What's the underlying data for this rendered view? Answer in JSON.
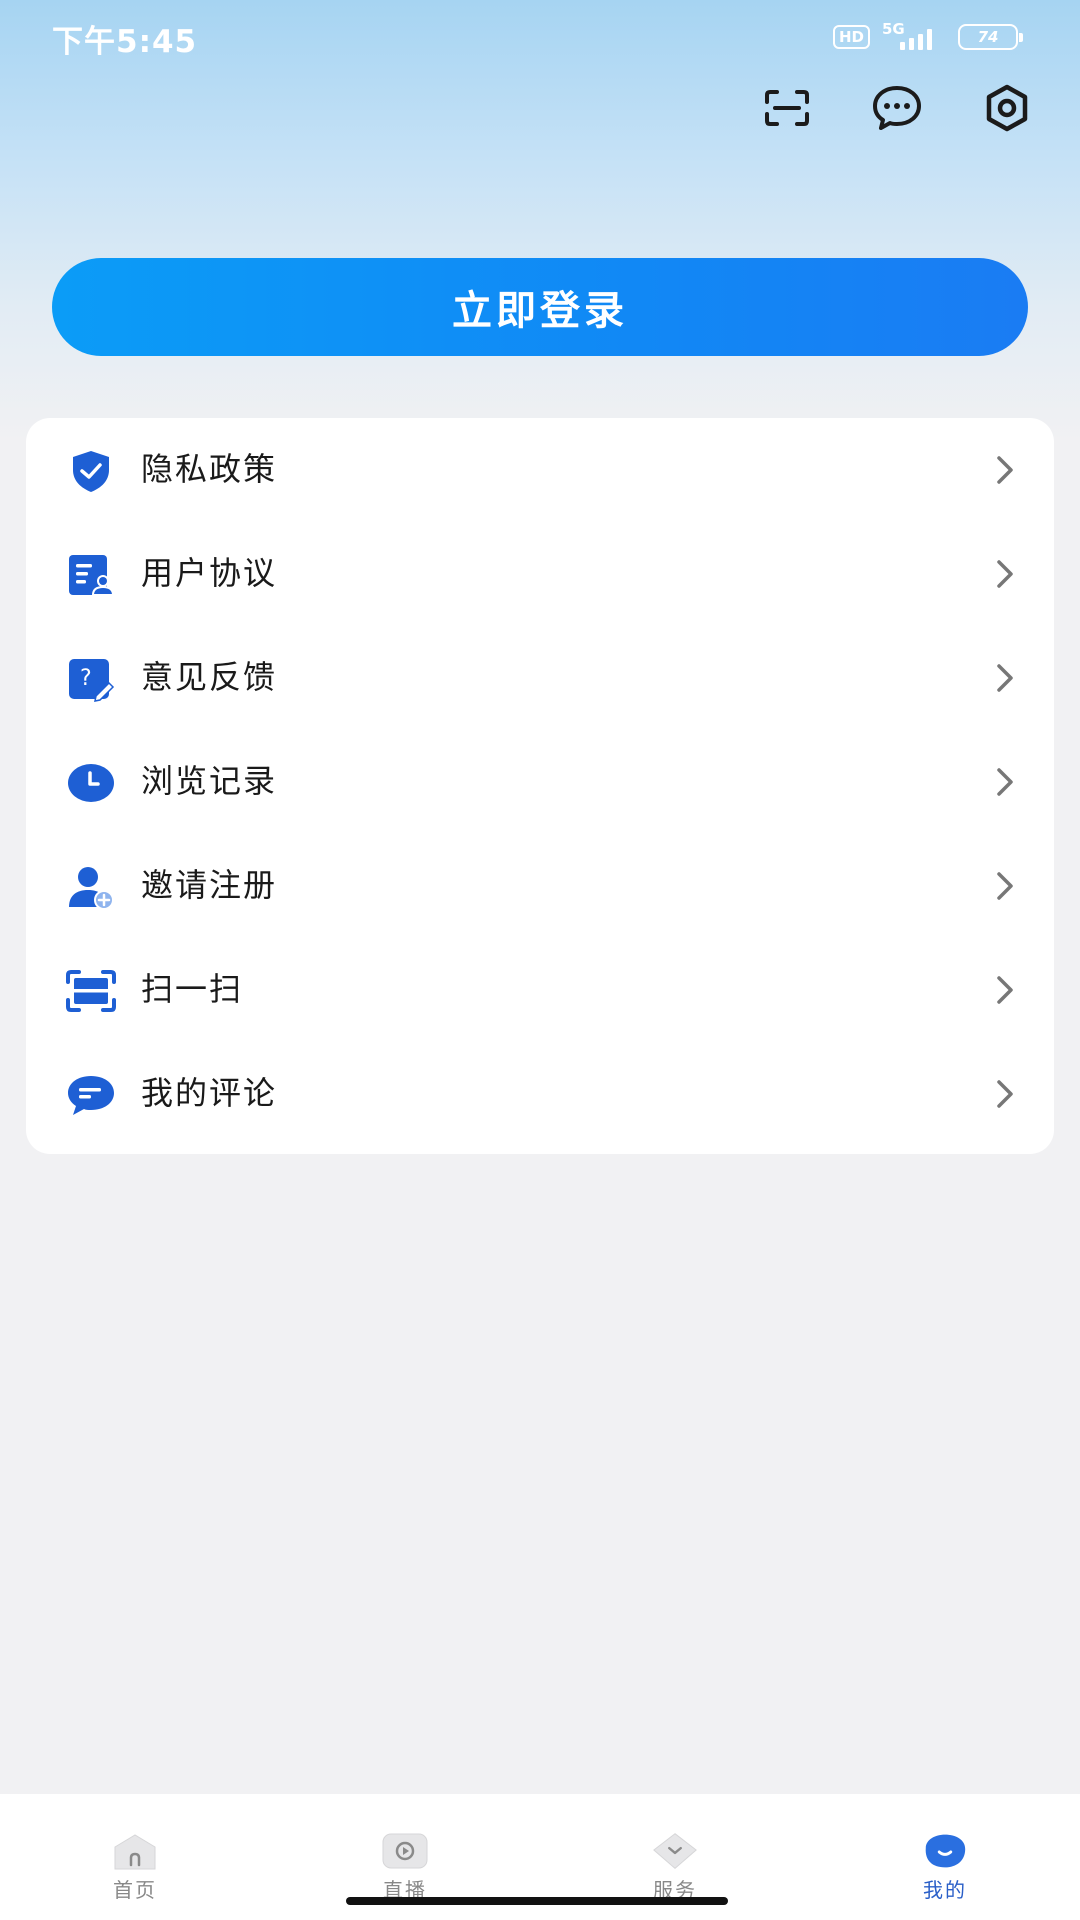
{
  "status_bar": {
    "time": "下午5:45",
    "hd": "HD",
    "network": "5G",
    "battery": "74"
  },
  "header": {
    "icons": [
      "scan-icon",
      "message-icon",
      "settings-icon"
    ]
  },
  "login_button": "立即登录",
  "menu": {
    "items": [
      {
        "label": "隐私政策",
        "icon": "shield-check-icon"
      },
      {
        "label": "用户协议",
        "icon": "agreement-icon"
      },
      {
        "label": "意见反馈",
        "icon": "feedback-icon"
      },
      {
        "label": "浏览记录",
        "icon": "clock-icon"
      },
      {
        "label": "邀请注册",
        "icon": "invite-user-icon"
      },
      {
        "label": "扫一扫",
        "icon": "scan-icon"
      },
      {
        "label": "我的评论",
        "icon": "comment-icon"
      }
    ]
  },
  "tabbar": {
    "tabs": [
      {
        "label": "首页",
        "icon": "home-icon",
        "active": false
      },
      {
        "label": "直播",
        "icon": "live-icon",
        "active": false
      },
      {
        "label": "服务",
        "icon": "service-icon",
        "active": false
      },
      {
        "label": "我的",
        "icon": "profile-icon",
        "active": true
      }
    ]
  },
  "colors": {
    "accent": "#1a7cf3",
    "icon_blue": "#1e5fd4",
    "active_tab": "#2a5fc8"
  }
}
